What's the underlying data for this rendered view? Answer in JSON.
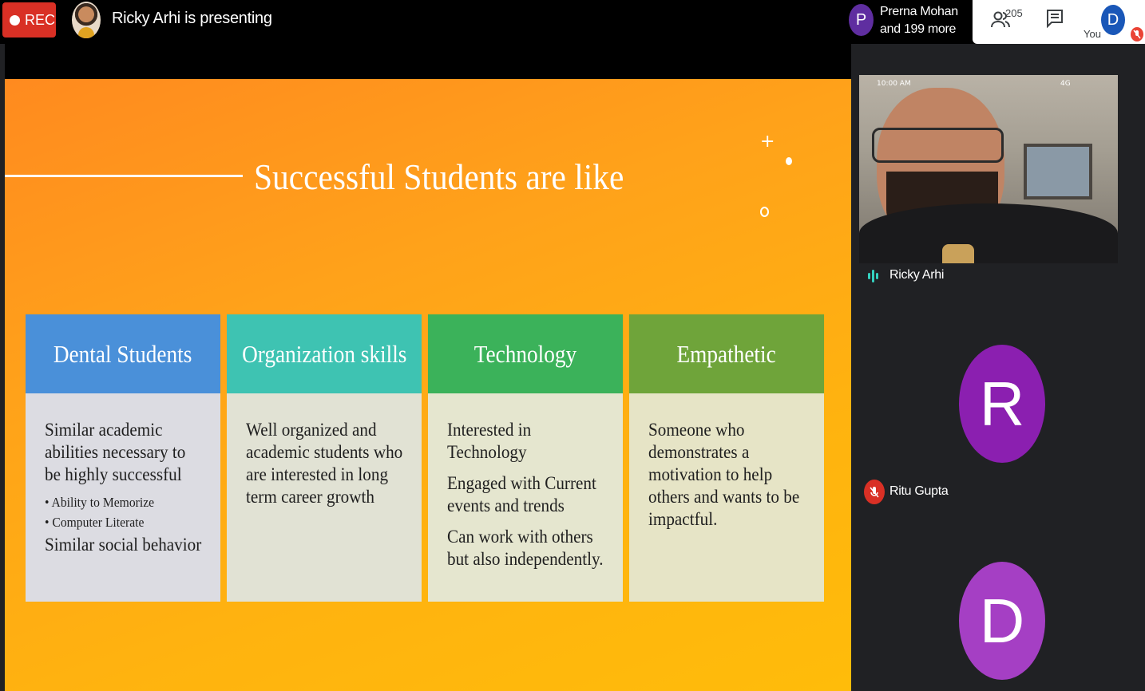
{
  "topbar": {
    "rec_label": "REC",
    "presenting_text": "Ricky Arhi is presenting",
    "others_initial": "P",
    "others_line1": "Prerna Mohan",
    "others_line2": "and 199 more",
    "people_count": "205",
    "you_initial": "D",
    "you_label": "You"
  },
  "slide": {
    "title": "Successful Students are like",
    "cards": [
      {
        "heading": "Dental Students",
        "paragraphs": [
          "Similar academic abilities necessary to be highly successful"
        ],
        "bullets": [
          "Ability to Memorize",
          "Computer Literate"
        ],
        "after": "Similar social behavior"
      },
      {
        "heading": "Organization skills",
        "paragraphs": [
          "Well organized and academic students who are interested in long term career growth"
        ]
      },
      {
        "heading": "Technology",
        "paragraphs": [
          "Interested in Technology",
          "Engaged with Current events and trends",
          "Can work with others but also independently."
        ]
      },
      {
        "heading": "Empathetic",
        "paragraphs": [
          "Someone who demonstrates a motivation to help others and wants to be impactful."
        ]
      }
    ]
  },
  "participants": {
    "video_time": "10:00 AM",
    "video_signal": "4G",
    "presenter_name": "Ricky Arhi",
    "p2_initial": "R",
    "p2_name": "Ritu Gupta",
    "p3_initial": "D"
  },
  "colors": {
    "rec": "#d93025",
    "header_blue": "#4a90d9",
    "header_teal": "#3ec3b2",
    "header_green": "#3bb25a",
    "header_olive": "#6fa43a",
    "avatar_purple": "#8b1fb0",
    "avatar_violet": "#a53fc4"
  }
}
